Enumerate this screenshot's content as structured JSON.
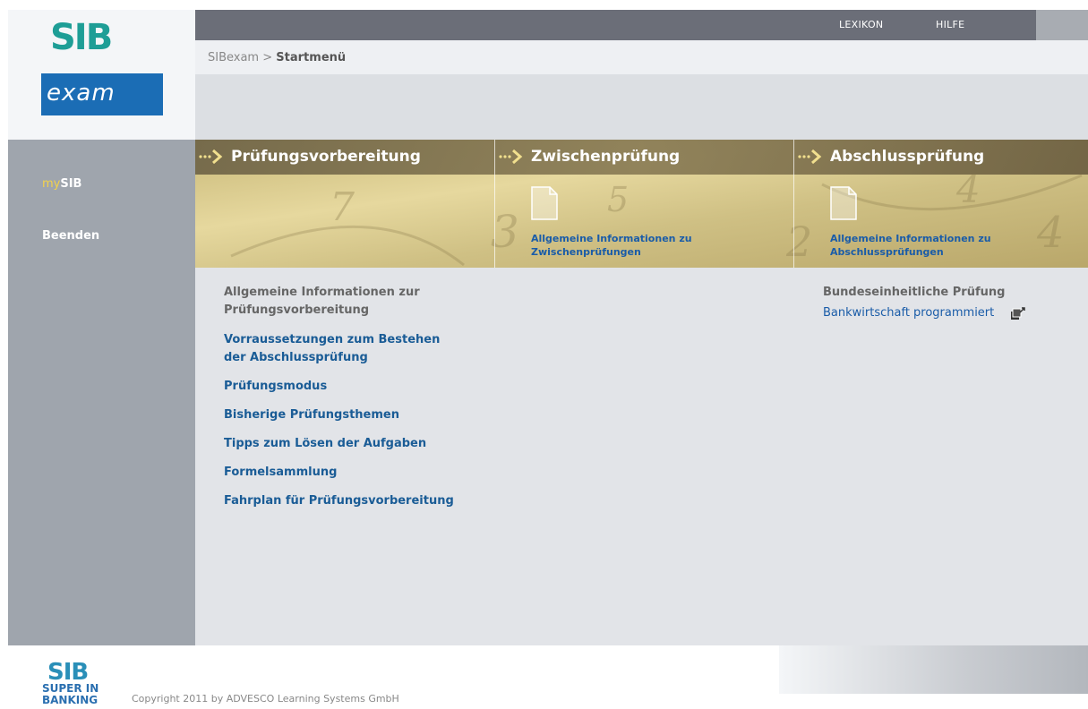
{
  "brand": {
    "logo_top": "SIB",
    "logo_bottom": "exam",
    "footer_logo_top": "SIB",
    "footer_logo_bottom": "SUPER IN BANKING"
  },
  "topnav": {
    "lexikon": "LEXIKON",
    "hilfe": "HILFE"
  },
  "breadcrumb": {
    "root": "SIBexam",
    "separator": ">",
    "current": "Startmenü"
  },
  "sidebar": {
    "mysib_prefix": "my",
    "mysib_suffix": "SIB",
    "exit": "Beenden"
  },
  "tabs": [
    {
      "label": "Prüfungsvorbereitung"
    },
    {
      "label": "Zwischenprüfung",
      "link_line1": "Allgemeine Informationen zu",
      "link_line2": "Zwischenprüfungen"
    },
    {
      "label": "Abschlussprüfung",
      "link_line1": "Allgemeine Informationen zu",
      "link_line2": "Abschlussprüfungen"
    }
  ],
  "content": {
    "intro_line1": "Allgemeine Informationen zur",
    "intro_line2": "Prüfungsvorbereitung",
    "links": [
      {
        "line1": "Vorraussetzungen zum Bestehen",
        "line2": "der Abschlussprüfung"
      },
      {
        "line1": "Prüfungsmodus"
      },
      {
        "line1": "Bisherige Prüfungsthemen"
      },
      {
        "line1": "Tipps zum Lösen der Aufgaben"
      },
      {
        "line1": "Formelsammlung"
      },
      {
        "line1": "Fahrplan für Prüfungsvorbereitung"
      }
    ],
    "right_heading": "Bundeseinheitliche Prüfung",
    "right_link": "Bankwirtschaft programmiert"
  },
  "footer": {
    "copyright": "Copyright 2011 by ADVESCO Learning Systems GmbH"
  },
  "colors": {
    "topbar": "#6b6e78",
    "sidebar": "#9fa5ad",
    "link": "#1a5c96",
    "accent_yellow": "#f3d24a",
    "logo_teal": "#1e9e96",
    "logo_blue": "#1b6db5"
  }
}
